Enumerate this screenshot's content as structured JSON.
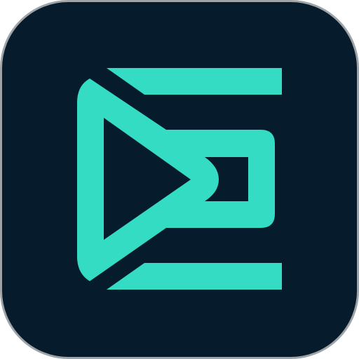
{
  "icon": {
    "name": "video-play-logo-icon",
    "colors": {
      "background": "#061c2d",
      "border": "#9ea3a7",
      "accent": "#34dcc3"
    }
  }
}
